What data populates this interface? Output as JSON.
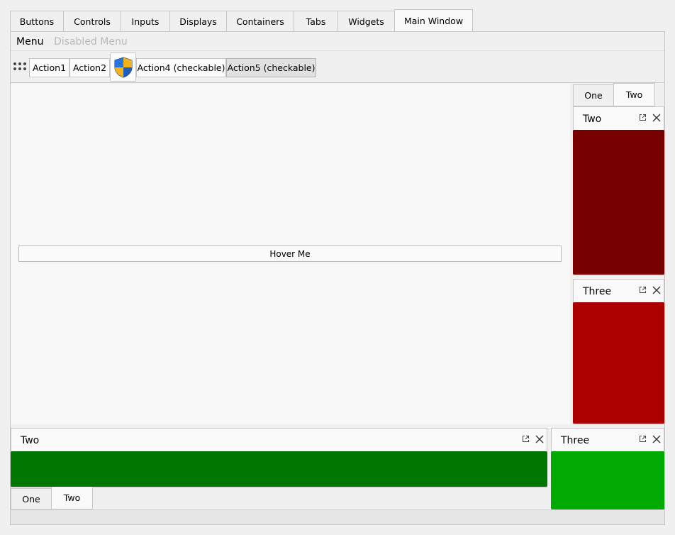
{
  "tabs": [
    {
      "label": "Buttons"
    },
    {
      "label": "Controls"
    },
    {
      "label": "Inputs"
    },
    {
      "label": "Displays"
    },
    {
      "label": "Containers"
    },
    {
      "label": "Tabs"
    },
    {
      "label": "Widgets"
    },
    {
      "label": "Main Window",
      "active": true
    }
  ],
  "menubar": {
    "menu": "Menu",
    "disabled_menu": "Disabled Menu"
  },
  "toolbar": {
    "action1": "Action1",
    "action2": "Action2",
    "action3_icon": "shield-icon",
    "action4": "Action4 (checkable)",
    "action5": "Action5 (checkable)"
  },
  "central": {
    "hover_button": "Hover Me"
  },
  "right_dock_tabs": [
    "One",
    "Two"
  ],
  "right_docks": [
    {
      "title": "Two",
      "color": "#770000"
    },
    {
      "title": "Three",
      "color": "#aa0000"
    }
  ],
  "bottom_docks": [
    {
      "title": "Two",
      "color": "#007700"
    },
    {
      "title": "Three",
      "color": "#00aa00"
    }
  ],
  "bottom_dock_tabs": [
    "One",
    "Two"
  ],
  "colors": {
    "accent_border": "#c6c6c6",
    "dark_red": "#770000",
    "red": "#aa0000",
    "dark_green": "#007700",
    "green": "#00aa00"
  }
}
